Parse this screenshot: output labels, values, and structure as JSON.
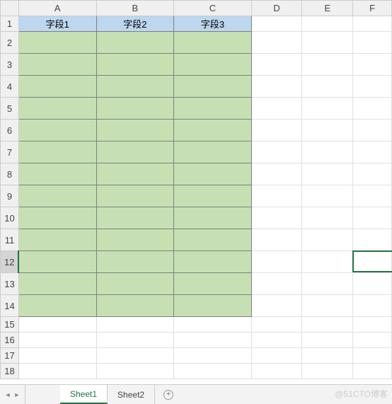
{
  "columns": [
    "A",
    "B",
    "C",
    "D",
    "E",
    "F"
  ],
  "rows": [
    1,
    2,
    3,
    4,
    5,
    6,
    7,
    8,
    9,
    10,
    11,
    12,
    13,
    14,
    15,
    16,
    17,
    18
  ],
  "headerRow": {
    "labels": [
      "字段1",
      "字段2",
      "字段3"
    ]
  },
  "greenRows": {
    "start": 2,
    "end": 14
  },
  "tallRows": [
    2,
    3,
    4,
    5,
    6,
    7,
    8,
    9,
    10,
    11,
    12,
    13,
    14
  ],
  "activeRow": 12,
  "selectedCell": {
    "row": 12,
    "col": "F"
  },
  "tabs": [
    {
      "name": "Sheet1",
      "active": true
    },
    {
      "name": "Sheet2",
      "active": false
    }
  ],
  "watermark": "@51CTO博客"
}
